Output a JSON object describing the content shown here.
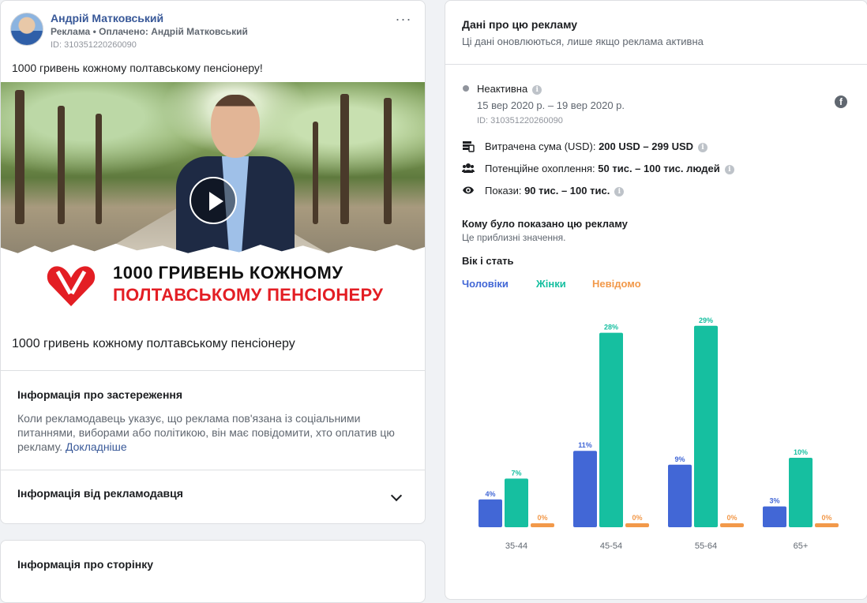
{
  "ad": {
    "advertiser_name": "Андрій Матковський",
    "sponsored_label": "Реклама",
    "paid_by": "Оплачено: Андрій Матковський",
    "id_label": "ID: 310351220260090",
    "body_text": "1000 гривень кожному полтавському пенсіонеру!",
    "banner_line1": "1000 ГРИВЕНЬ КОЖНОМУ",
    "banner_line2": "ПОЛТАВСЬКОМУ ПЕНСІОНЕРУ",
    "caption": "1000 гривень кожному полтавському пенсіонеру"
  },
  "disclaimer": {
    "title": "Інформація про застереження",
    "text": "Коли рекламодавець указує, що реклама пов'язана із соціальними питаннями, виборами або політикою, він має повідомити, хто оплатив цю рекламу.",
    "link": "Докладніше"
  },
  "advertiser_info": {
    "title": "Інформація від рекламодавця"
  },
  "page_info": {
    "title": "Інформація про сторінку"
  },
  "data_panel": {
    "title": "Дані про цю рекламу",
    "subtitle": "Ці дані оновлюються, лише якщо реклама активна",
    "status": "Неактивна",
    "dates": "15 вер 2020 р. – 19 вер 2020 р.",
    "id_label": "ID: 310351220260090",
    "spend_label": "Витрачена сума (USD): ",
    "spend_value": "200 USD – 299 USD",
    "reach_label": "Потенційне охоплення: ",
    "reach_value": "50 тис. – 100 тис. людей",
    "impressions_label": "Покази: ",
    "impressions_value": "90 тис. – 100 тис.",
    "audience_title": "Кому було показано цю рекламу",
    "audience_sub": "Це приблизні значення.",
    "age_gender_title": "Вік і стать",
    "legend_men": "Чоловіки",
    "legend_women": "Жінки",
    "legend_unknown": "Невідомо"
  },
  "colors": {
    "men": "#4267d6",
    "women": "#16bfa0",
    "unknown": "#f2994a",
    "link": "#385898"
  },
  "chart_data": {
    "type": "bar",
    "categories": [
      "35-44",
      "45-54",
      "55-64",
      "65+"
    ],
    "series": [
      {
        "name": "Чоловіки",
        "values": [
          4,
          11,
          9,
          3
        ]
      },
      {
        "name": "Жінки",
        "values": [
          7,
          28,
          29,
          10
        ]
      },
      {
        "name": "Невідомо",
        "values": [
          0,
          0,
          0,
          0
        ]
      }
    ],
    "value_suffix": "%"
  }
}
